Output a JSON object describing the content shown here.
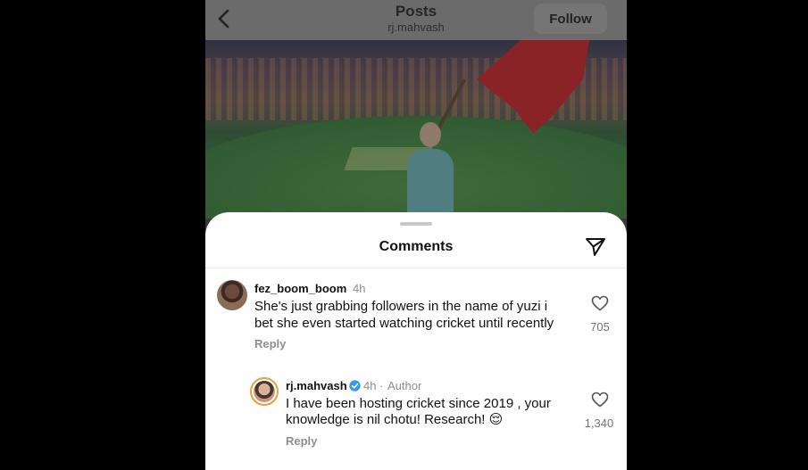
{
  "header": {
    "title": "Posts",
    "subtitle": "rj.mahvash",
    "follow_label": "Follow"
  },
  "sheet": {
    "title": "Comments"
  },
  "comments": [
    {
      "username": "fez_boom_boom",
      "time": "4h",
      "text_line1": "She's just grabbing followers in the name of yuzi i",
      "text_line2": "bet she even started watching cricket until recently",
      "reply_label": "Reply",
      "likes": "705"
    },
    {
      "username": "rj.mahvash",
      "time": "4h",
      "author_tag": "Author",
      "text_line1": "I have been hosting cricket since 2019 , your",
      "text_line2": "knowledge is nil chotu! Research! 😌",
      "reply_label": "Reply",
      "likes": "1,340"
    }
  ],
  "icons": {
    "back": "chevron-left-icon",
    "share": "paper-plane-icon",
    "like": "heart-icon",
    "verified": "verified-badge-icon"
  },
  "colors": {
    "verified_blue": "#3897f0",
    "story_ring": "#e0a33a"
  }
}
